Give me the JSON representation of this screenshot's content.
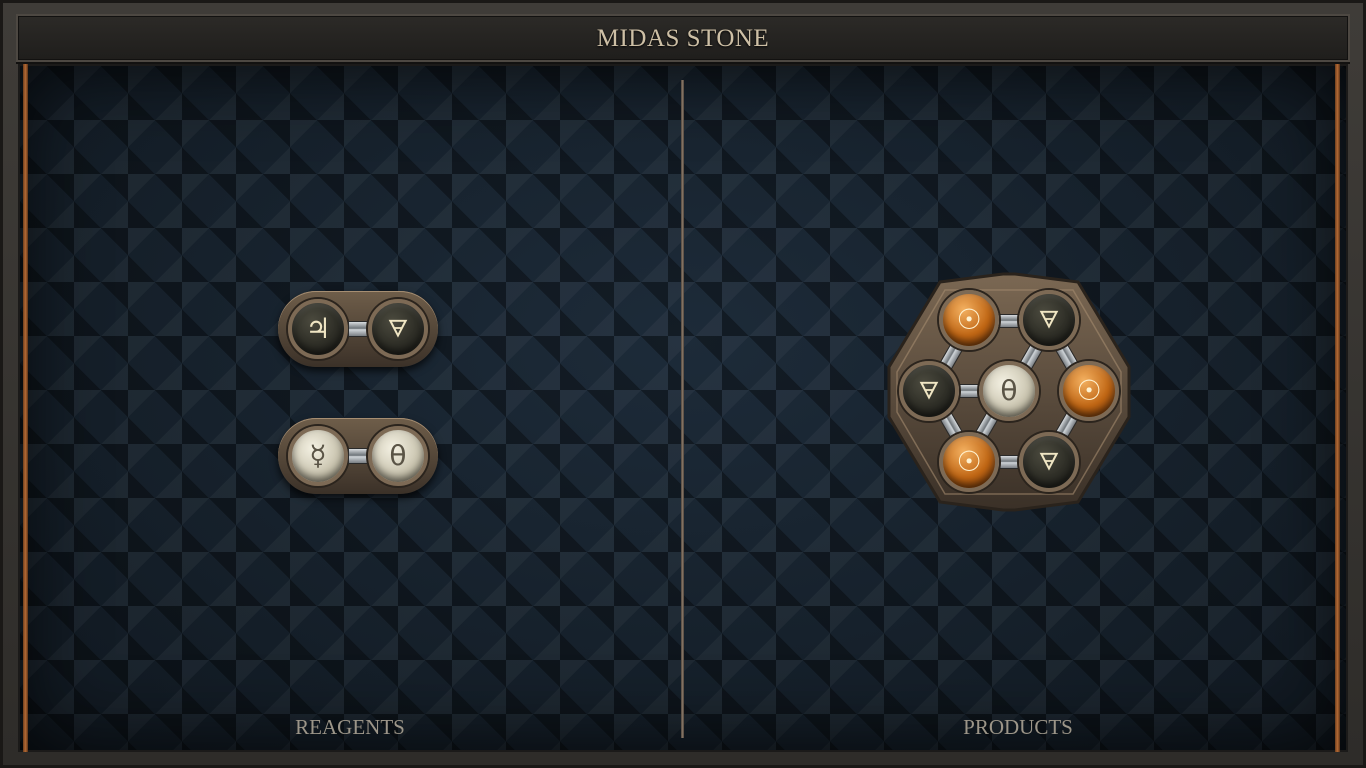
{
  "title": "MIDAS STONE",
  "panels": {
    "reagents_label": "REAGENTS",
    "products_label": "PRODUCTS"
  },
  "reagents": [
    {
      "atoms": [
        {
          "symbol": "♃",
          "element": "tin",
          "style": "dark"
        },
        {
          "symbol": "🜃",
          "element": "earth",
          "style": "dark"
        }
      ]
    },
    {
      "atoms": [
        {
          "symbol": "☿",
          "element": "quicksilver",
          "style": "pale"
        },
        {
          "symbol": "θ",
          "element": "salt",
          "style": "pale"
        }
      ]
    }
  ],
  "product": {
    "atoms": [
      {
        "symbol": "☉",
        "element": "gold",
        "style": "gold"
      },
      {
        "symbol": "🜃",
        "element": "earth",
        "style": "dark"
      },
      {
        "symbol": "🜃",
        "element": "earth",
        "style": "dark"
      },
      {
        "symbol": "θ",
        "element": "salt",
        "style": "pale"
      },
      {
        "symbol": "☉",
        "element": "gold",
        "style": "gold"
      },
      {
        "symbol": "☉",
        "element": "gold",
        "style": "gold"
      },
      {
        "symbol": "🜃",
        "element": "earth",
        "style": "dark"
      }
    ]
  },
  "colors": {
    "frame": "#3f3c38",
    "board": "#17212c",
    "title_text": "#cdbfa5",
    "label_text": "#9c9588",
    "accent_copper": "#b46a34"
  }
}
